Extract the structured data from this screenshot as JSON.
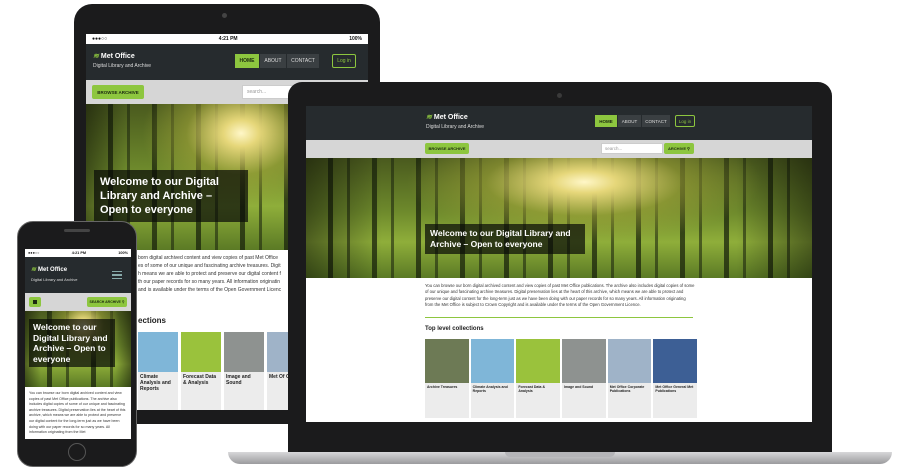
{
  "status": {
    "carrier": "●●●○○",
    "time": "4:21 PM",
    "battery": "100%"
  },
  "site": {
    "logo_mark": "≋",
    "logo_text": "Met Office",
    "subtitle": "Digital Library and Archive",
    "nav": [
      "HOME",
      "ABOUT",
      "CONTACT"
    ],
    "login": "Log in",
    "browse": "BROWSE ARCHIVE",
    "search_placeholder": "search...",
    "search_button": "ARCHIVE",
    "search_button_mobile": "SEARCH ARCHIVE",
    "hero_title": "Welcome to our Digital Library and Archive – Open to everyone",
    "intro": "You can browse our born digital archived content and view copies of past Met Office publications. The archive also includes digital copies of some of our unique and fascinating archive treasures. Digital preservation lies at the heart of this archive, which means we are able to protect and preserve our digital content for the long-term just as we have been doing with our paper records for so many years. All information originating from the Met Office is subject to Crown Copyright and is available under the terms of the Open Government Licence.",
    "collections_title": "Top level collections",
    "collections_title_tablet": "ections",
    "collections": [
      {
        "label": "Archive Treasures",
        "color": "#6d7a55"
      },
      {
        "label": "Climate Analysis and Reports",
        "color": "#7fb6d8"
      },
      {
        "label": "Forecast Data & Analysis",
        "color": "#9ac23c"
      },
      {
        "label": "Image and Sound",
        "color": "#8e9290"
      },
      {
        "label": "Met Office Corporate Publications",
        "color": "#9fb3c8"
      },
      {
        "label": "Met Office General Met Publications",
        "color": "#3d5f95"
      }
    ],
    "tablet_collections": [
      "Climate Analysis and Reports",
      "Forecast Data & Analysis",
      "Image and Sound",
      "Met Of Corpo"
    ]
  },
  "tablet_intro_lines": [
    "born digital archived content and view copies of past Met Office",
    "es of some of our unique and fascinating archive treasures. Digit",
    "h means we are able to protect and preserve our digital content f",
    "th our paper records for so many years. All information originatin",
    "and is available under the terms of the Open Government Licenc"
  ],
  "mobile_intro": "You can browse our born digital archived content and view copies of past Met Office publications. The archive also includes digital copies of some of our unique and fascinating archive treasures. Digital preservation lies at the heart of this archive, which means we are able to protect and preserve our digital content for the long-term just as we have been doing with our paper records for so many years. All information originating from the Met"
}
